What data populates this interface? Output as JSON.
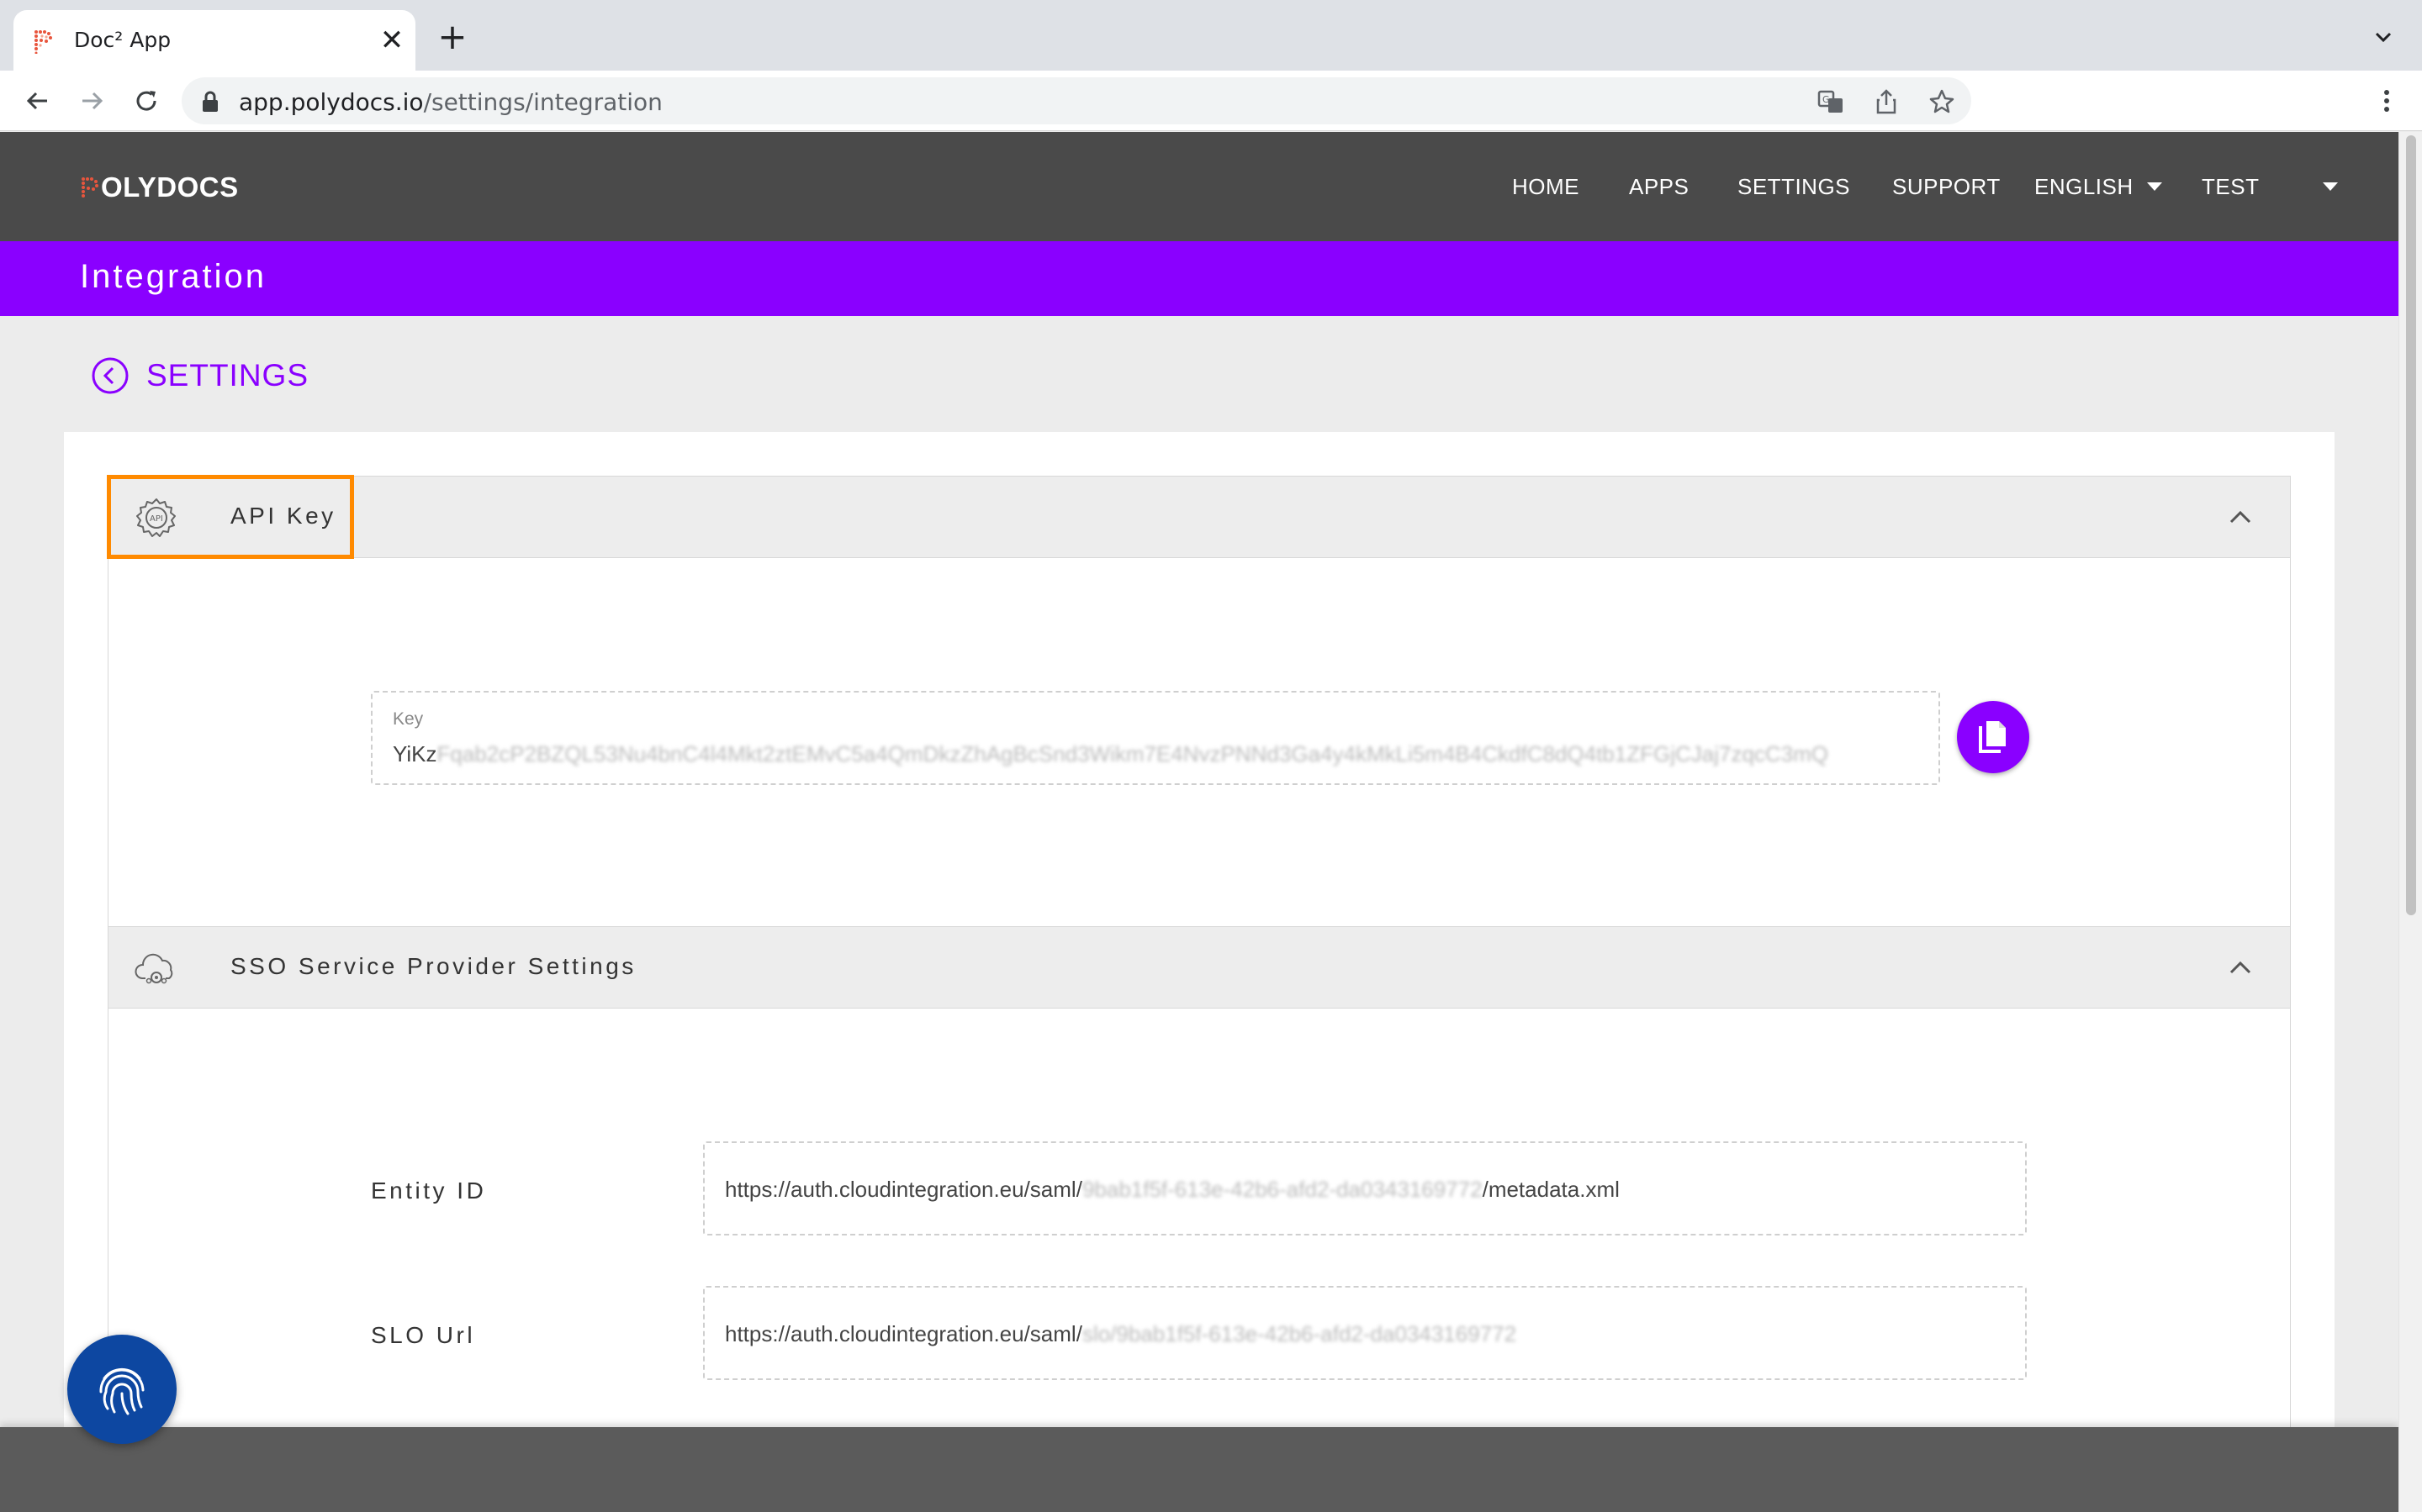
{
  "browser": {
    "tab_title": "Doc² App",
    "tab_close": "✕",
    "new_tab": "+",
    "url_host": "app.polydocs.io",
    "url_path": "/settings/integration"
  },
  "app": {
    "logo_text": "OLYDOCS",
    "nav": {
      "home": "HOME",
      "apps": "APPS",
      "settings": "SETTINGS",
      "support": "SUPPORT",
      "language": "ENGLISH",
      "user": "TEST"
    },
    "page_title": "Integration",
    "back_label": "SETTINGS"
  },
  "api_key": {
    "title": "API Key",
    "field_label": "Key",
    "value_visible": "YiKz",
    "value_obscured": "Fqab2cP2BZQL53Nu4bnC4l4Mkt2ztEMvC5a4QmDkzZhAgBcSnd3Wikm7E4NvzPNNd3Ga4y4kMkLi5m4B4CkdfC8dQ4tb1ZFGjCJaj7zqcC3mQ"
  },
  "sso": {
    "title": "SSO Service Provider Settings",
    "entity_id_label": "Entity ID",
    "entity_id_prefix": "https://auth.cloudintegration.eu/saml/",
    "entity_id_obscured": "9bab1f5f-613e-42b6-afd2-da0343169772",
    "entity_id_suffix": "/metadata.xml",
    "slo_url_label": "SLO Url",
    "slo_url_prefix": "https://auth.cloudintegration.eu/saml/",
    "slo_url_obscured": "slo/9bab1f5f-613e-42b6-afd2-da0343169772"
  },
  "colors": {
    "accent": "#8a00ff",
    "nav_bg": "#4a4a4a",
    "highlight": "#ff8a00",
    "fab": "#0d47a1"
  }
}
